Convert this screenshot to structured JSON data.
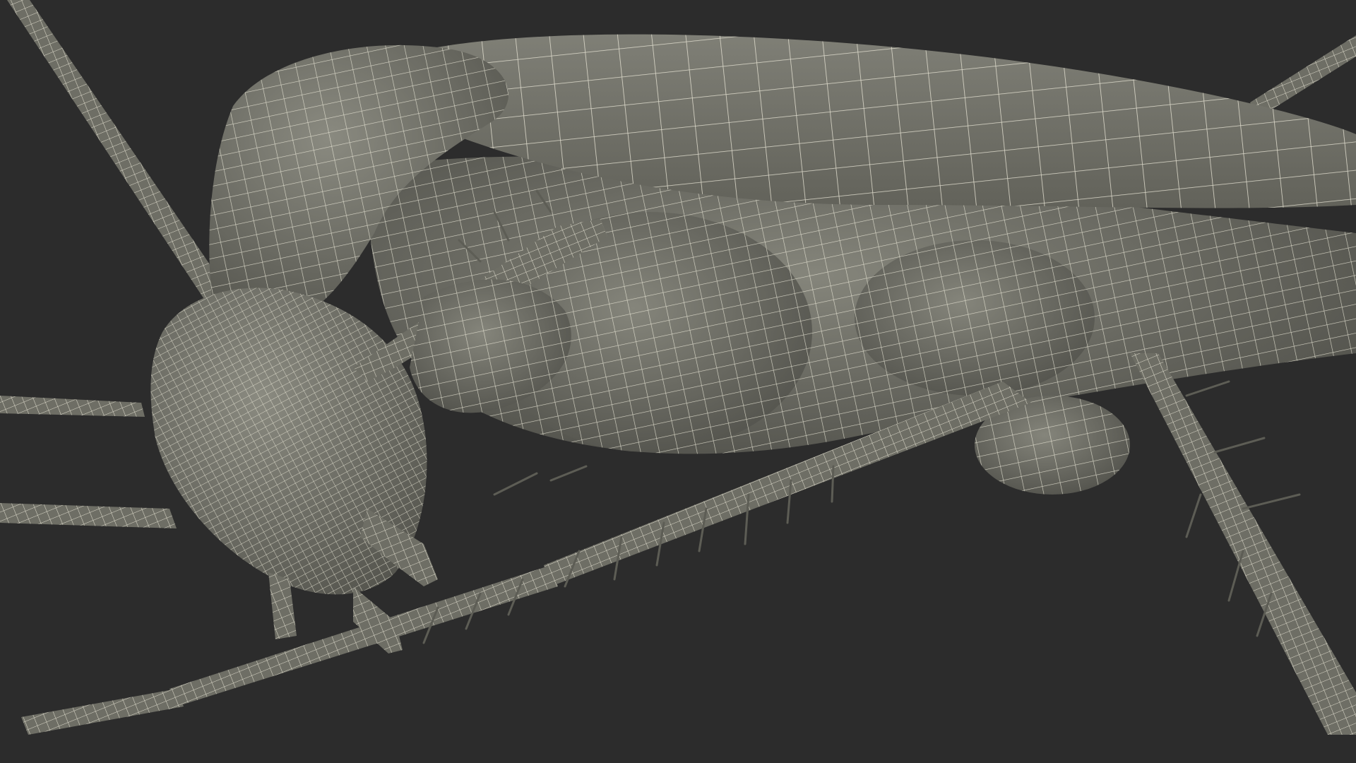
{
  "scene": {
    "subject": "insect-wireframe-render",
    "background_color": "#2c2c2c",
    "surface_color": "#6e6e65",
    "surface_shadow_color": "#4f4f49",
    "surface_highlight_color": "#8a8a80",
    "wire_color": "#e9e6d6",
    "spine_color": "#5d5d55"
  }
}
